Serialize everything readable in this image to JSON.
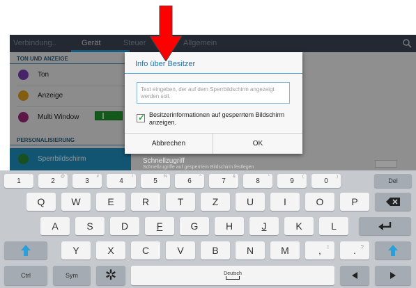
{
  "tabs": [
    {
      "label": "Verbindung..",
      "active": false
    },
    {
      "label": "Gerät",
      "active": true
    },
    {
      "label": "Steuer",
      "active": false
    },
    {
      "label": "Allgemein",
      "active": false
    }
  ],
  "left_panel": {
    "section1": "TON UND ANZEIGE",
    "items": [
      {
        "label": "Ton",
        "icon": "sound-icon",
        "color": "#7b3fb5"
      },
      {
        "label": "Anzeige",
        "icon": "display-icon",
        "color": "#e2a11c"
      },
      {
        "label": "Multi Window",
        "icon": "multi-window-icon",
        "color": "#a0287a"
      }
    ],
    "section2": "PERSONALISIERUNG",
    "selected": {
      "label": "Sperrbildschirm",
      "icon": "lockscreen-icon",
      "color": "#2a8a3c"
    }
  },
  "dialog": {
    "title": "Info über Besitzer",
    "input_placeholder": "Text eingeben, der auf dem Sperrbildschirm angezeigt werden soll.",
    "checkbox_checked": true,
    "checkbox_label": "Besitzerinformationen auf gesperrtem Bildschirm anzeigen.",
    "cancel_label": "Abbrechen",
    "ok_label": "OK"
  },
  "quick_access": {
    "title": "Schnellzugriff",
    "subtitle": "Schnellzugriffe auf gesperrtem Bildschirm festlegen"
  },
  "keyboard": {
    "row1": [
      {
        "k": "1",
        "s": "`"
      },
      {
        "k": "2",
        "s": "@"
      },
      {
        "k": "3",
        "s": "#"
      },
      {
        "k": "4",
        "s": "/"
      },
      {
        "k": "5",
        "s": "%"
      },
      {
        "k": "6",
        "s": "^"
      },
      {
        "k": "7",
        "s": "&"
      },
      {
        "k": "8",
        "s": "*"
      },
      {
        "k": "9",
        "s": "("
      },
      {
        "k": "0",
        "s": ")"
      }
    ],
    "del": "Del",
    "row2": [
      "Q",
      "W",
      "E",
      "R",
      "T",
      "Z",
      "U",
      "I",
      "O",
      "P"
    ],
    "row3": [
      "A",
      "S",
      "D",
      "F",
      "G",
      "H",
      "J",
      "K",
      "L"
    ],
    "row4": [
      "Y",
      "X",
      "C",
      "V",
      "B",
      "N",
      "M"
    ],
    "row4_punct": [
      {
        "k": ",",
        "s": "!"
      },
      {
        "k": ".",
        "s": "?"
      }
    ],
    "ctrl": "Ctrl",
    "sym": "Sym",
    "space_label": "Deutsch"
  },
  "colors": {
    "accent": "#2a9fd8",
    "tabbar": "#3e4656",
    "arrow": "#ff0000"
  }
}
